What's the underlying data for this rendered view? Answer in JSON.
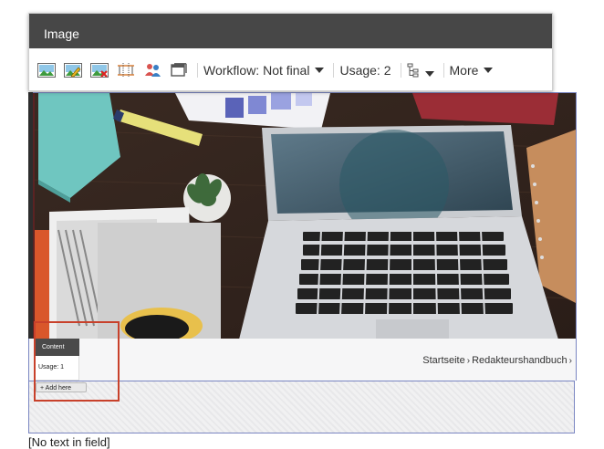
{
  "toolbar": {
    "title": "Image",
    "icons": [
      "image-icon",
      "edit-image-icon",
      "delete-image-icon",
      "crop-icon",
      "users-icon",
      "window-icon"
    ],
    "workflow_label": "Workflow: Not final",
    "usage_label": "Usage: 2",
    "tree_icon": "tree-icon",
    "more_label": "More"
  },
  "page": {
    "breadcrumb": [
      "Startseite",
      "Redakteurshandbuch"
    ],
    "breadcrumb_sep": "›"
  },
  "content_widget": {
    "header": "Content",
    "usage": "Usage: 1",
    "add_here": "+ Add here"
  },
  "footer": {
    "text": "[No text in field]"
  },
  "colors": {
    "toolbar_header": "#474747",
    "frame_border": "#7a86c2",
    "highlight_box": "#c8412b"
  }
}
